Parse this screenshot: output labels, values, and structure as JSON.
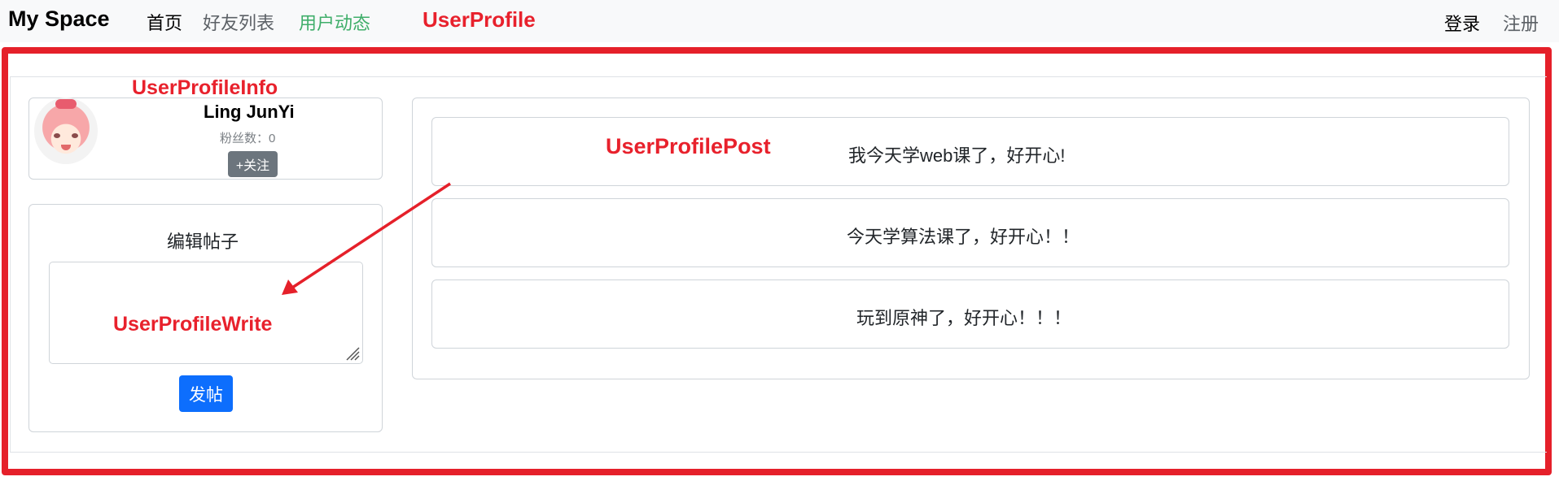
{
  "navbar": {
    "brand": "My Space",
    "links": [
      {
        "label": "首页"
      },
      {
        "label": "好友列表"
      },
      {
        "label": "用户动态"
      }
    ],
    "right_links": [
      {
        "label": "登录"
      },
      {
        "label": "注册"
      }
    ]
  },
  "annotations": {
    "user_profile": "UserProfile",
    "user_profile_info": "UserProfileInfo",
    "user_profile_post": "UserProfilePost",
    "user_profile_write": "UserProfileWrite"
  },
  "profile": {
    "username": "Ling JunYi",
    "fans": "粉丝数：0",
    "follow_label": "+关注"
  },
  "write": {
    "title": "编辑帖子",
    "textarea_value": "",
    "post_label": "发帖"
  },
  "posts": [
    {
      "content": "我今天学web课了，好开心!"
    },
    {
      "content": "今天学算法课了，好开心！！"
    },
    {
      "content": "玩到原神了，好开心！！！"
    }
  ],
  "colors": {
    "annotation_red": "#e5202a",
    "primary_button": "#0d6efd",
    "secondary_button": "#6c757d",
    "active_link_green": "#3fae6a"
  }
}
